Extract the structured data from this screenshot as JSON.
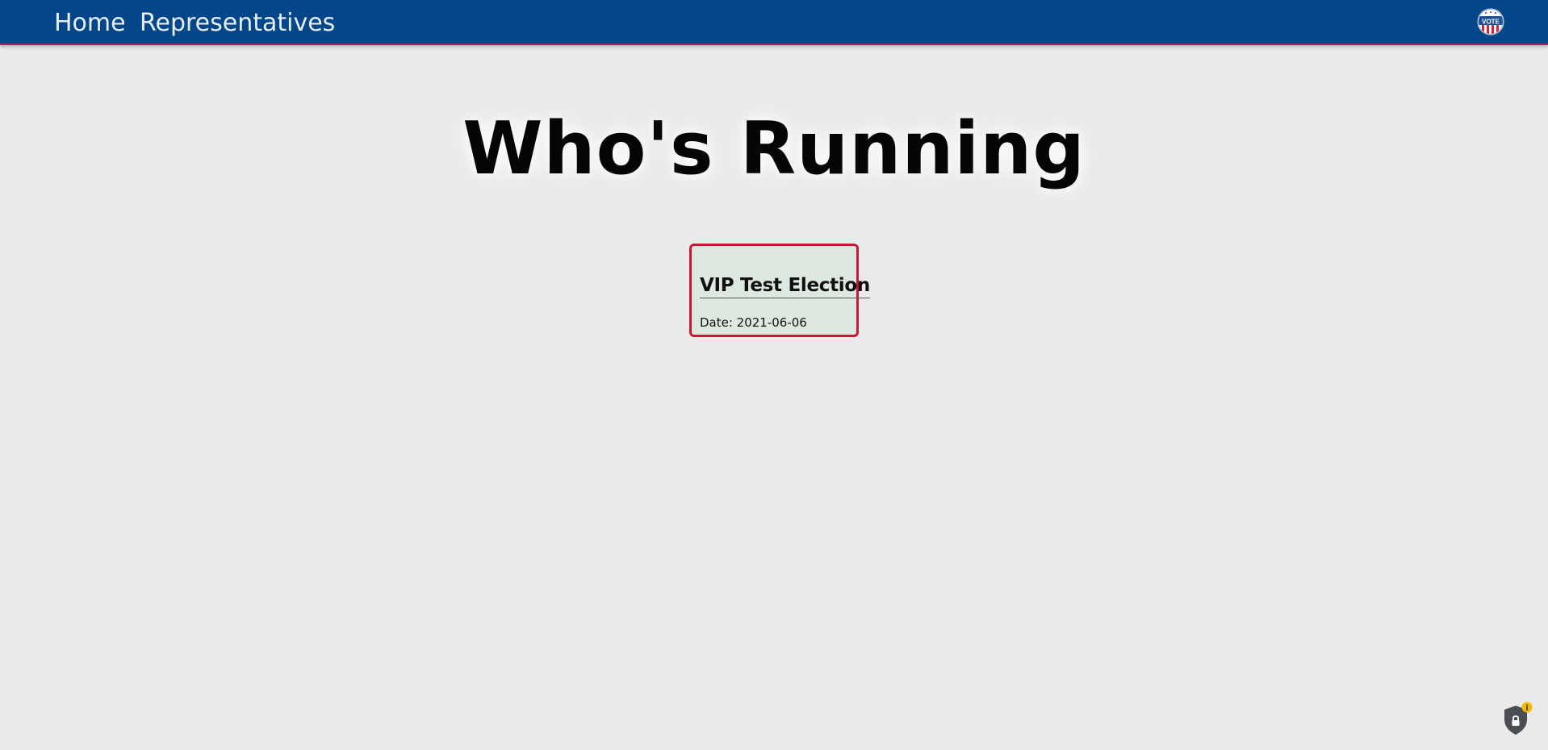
{
  "nav": {
    "links": [
      {
        "label": "Home"
      },
      {
        "label": "Representatives"
      }
    ],
    "badge_icon": "vote-badge-icon",
    "badge_text": "VOTE"
  },
  "main": {
    "title": "Who's Running",
    "elections": [
      {
        "name": "VIP Test Election",
        "date_label": "Date: 2021-06-06"
      }
    ]
  },
  "privacy_widget": {
    "icon": "shield-lock-icon",
    "badge_glyph": "i"
  },
  "colors": {
    "navbar": "#03478a",
    "background": "#eaeaea",
    "card_border": "#cc1638",
    "card_background": "#dde8e1"
  }
}
